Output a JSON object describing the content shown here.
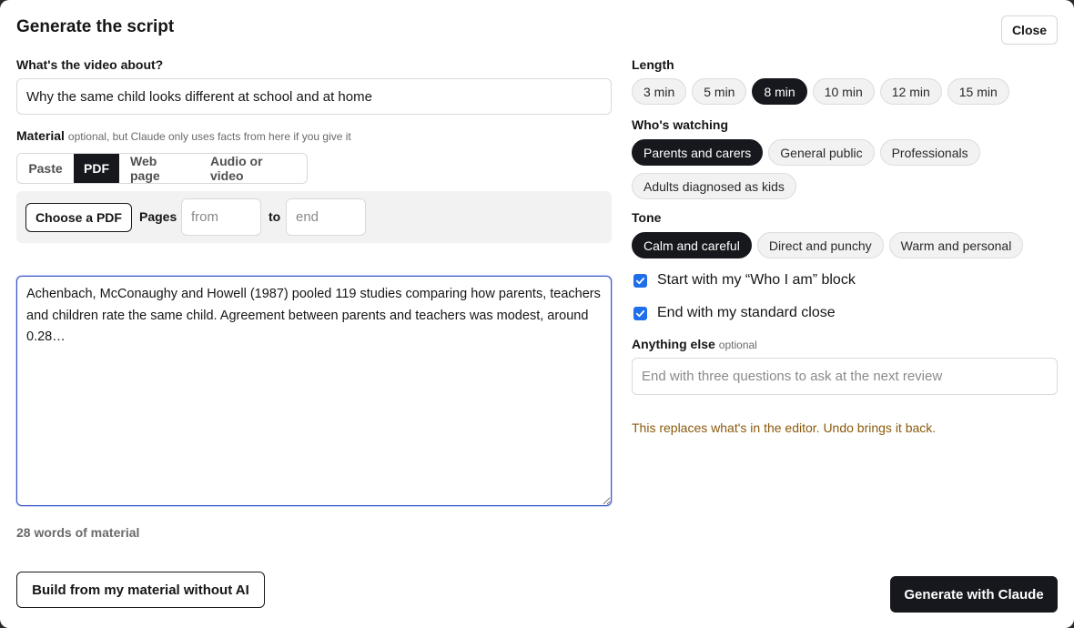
{
  "dialog": {
    "title": "Generate the script",
    "close_label": "Close"
  },
  "topic": {
    "label": "What's the video about?",
    "value": "Why the same child looks different at school and at home"
  },
  "material": {
    "label": "Material",
    "hint": "optional, but Claude only uses facts from here if you give it",
    "tabs": [
      {
        "label": "Paste",
        "active": false
      },
      {
        "label": "PDF",
        "active": true
      },
      {
        "label": "Web page",
        "active": false
      },
      {
        "label": "Audio or video",
        "active": false
      }
    ],
    "choose_pdf_label": "Choose a PDF",
    "pages_label": "Pages",
    "from_placeholder": "from",
    "to_label": "to",
    "end_placeholder": "end",
    "text": "Achenbach, McConaughy and Howell (1987) pooled 119 studies comparing how parents, teachers and children rate the same child. Agreement between parents and teachers was modest, around 0.28…",
    "word_count": "28 words of material"
  },
  "length": {
    "label": "Length",
    "options": [
      "3 min",
      "5 min",
      "8 min",
      "10 min",
      "12 min",
      "15 min"
    ],
    "selected": "8 min"
  },
  "audience": {
    "label": "Who's watching",
    "options": [
      "Parents and carers",
      "General public",
      "Professionals",
      "Adults diagnosed as kids"
    ],
    "selected": "Parents and carers"
  },
  "tone": {
    "label": "Tone",
    "options": [
      "Calm and careful",
      "Direct and punchy",
      "Warm and personal"
    ],
    "selected": "Calm and careful"
  },
  "options": {
    "start_block": {
      "label": "Start with my “Who I am” block",
      "checked": true
    },
    "end_close": {
      "label": "End with my standard close",
      "checked": true
    }
  },
  "anything_else": {
    "label": "Anything else",
    "hint": "optional",
    "placeholder": "End with three questions to ask at the next review"
  },
  "warning": "This replaces what's in the editor. Undo brings it back.",
  "actions": {
    "build_label": "Build from my material without AI",
    "generate_label": "Generate with Claude"
  },
  "colors": {
    "accent_dark": "#16181d",
    "checkbox": "#1f6feb",
    "warning": "#8a5a0a",
    "focus": "#3b55c7"
  }
}
